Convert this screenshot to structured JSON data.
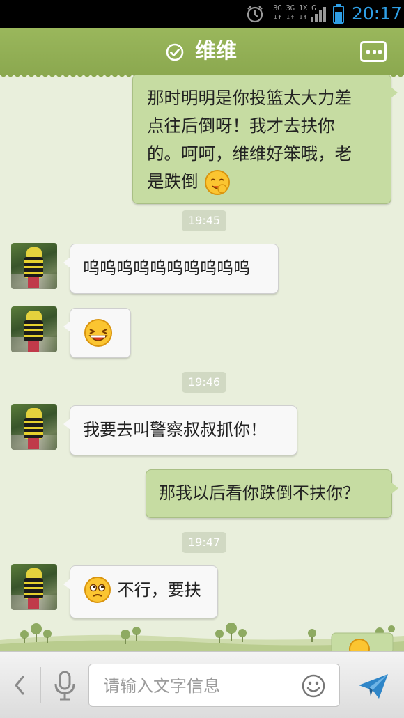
{
  "status_bar": {
    "net_top": "3G 3G 1X G",
    "net_bottom": "↓↑ ↓↑ ↓↑",
    "time": "20:17",
    "accent_color": "#2f9fe6"
  },
  "header": {
    "title": "维维",
    "status_icon": "check-circle-icon",
    "menu_icon": "more-icon",
    "color": "#93af57"
  },
  "messages": [
    {
      "direction": "sent",
      "lines": [
        "那时明明是你投篮太大力差",
        "点往后倒呀！我才去扶你",
        "的。呵呵，维维好笨哦，老",
        "是跌倒"
      ],
      "trailing_emoji": "shy-laugh-emoji"
    },
    {
      "type": "timestamp",
      "text": "19:45"
    },
    {
      "direction": "received",
      "text": "呜呜呜呜呜呜呜呜呜呜"
    },
    {
      "direction": "received",
      "emoji": "laughing-emoji"
    },
    {
      "type": "timestamp",
      "text": "19:46"
    },
    {
      "direction": "received",
      "text": "我要去叫警察叔叔抓你！"
    },
    {
      "direction": "sent",
      "text": "那我以后看你跌倒不扶你？"
    },
    {
      "type": "timestamp",
      "text": "19:47"
    },
    {
      "direction": "received",
      "leading_emoji": "thinking-emoji",
      "text": "不行，要扶"
    }
  ],
  "input_bar": {
    "placeholder": "请输入文字信息",
    "value": "",
    "icons": [
      "back-chevron-icon",
      "microphone-icon",
      "smiley-icon",
      "send-icon"
    ]
  },
  "colors": {
    "sent_bubble": "#c6dca2",
    "received_bubble": "#f8f8f8",
    "chat_background": "#e9efdc",
    "timestamp_badge": "#d1d9c3"
  }
}
